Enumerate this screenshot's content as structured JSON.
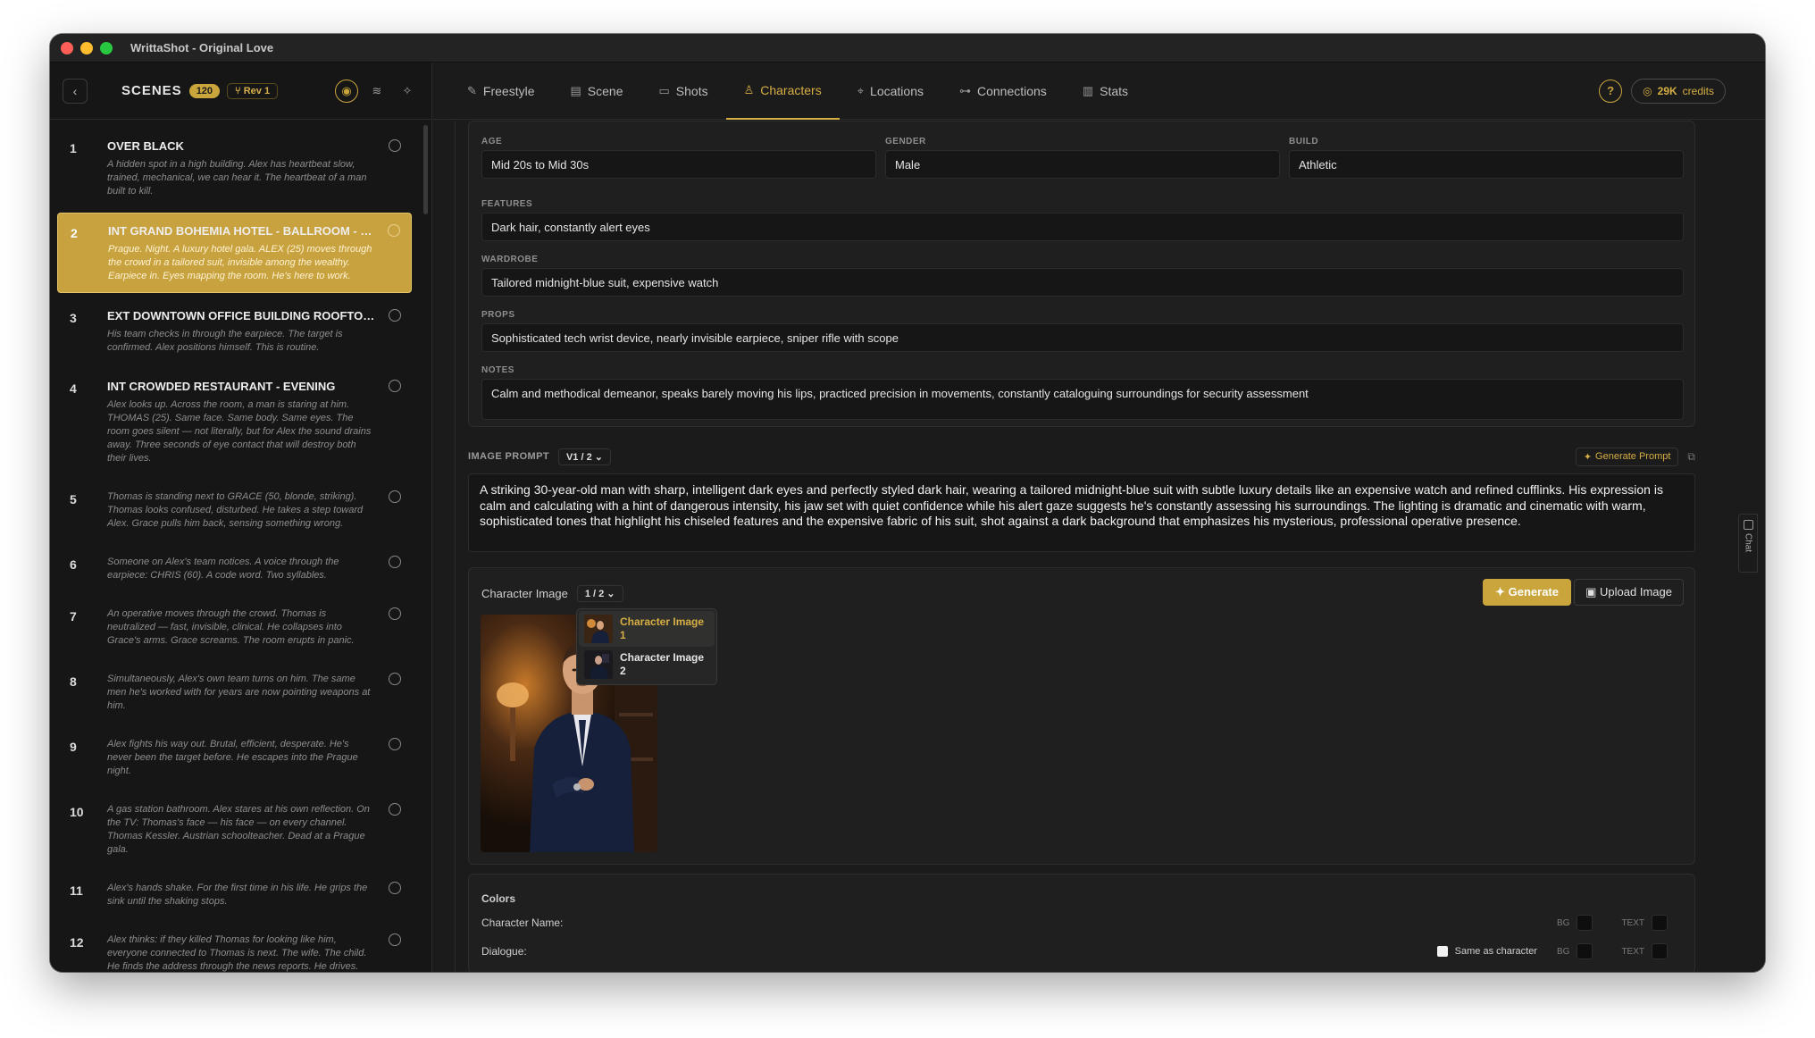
{
  "window": {
    "title": "WrittaShot - Original Love"
  },
  "sidebar": {
    "title": "SCENES",
    "count": "120",
    "rev": "Rev 1",
    "scenes": [
      {
        "num": "1",
        "heading": "OVER BLACK",
        "desc": "A hidden spot in a high building. Alex has heartbeat slow, trained, mechanical, we can hear it. The heartbeat of a man built to kill."
      },
      {
        "num": "2",
        "heading": "INT GRAND BOHEMIA HOTEL - BALLROOM - NI...",
        "desc": "Prague. Night. A luxury hotel gala. ALEX (25) moves through the crowd in a tailored suit, invisible among the wealthy. Earpiece in. Eyes mapping the room. He's here to work."
      },
      {
        "num": "3",
        "heading": "EXT DOWNTOWN OFFICE BUILDING ROOFTOP -...",
        "desc": "His team checks in through the earpiece. The target is confirmed. Alex positions himself. This is routine."
      },
      {
        "num": "4",
        "heading": "INT CROWDED RESTAURANT - EVENING",
        "desc": "Alex looks up. Across the room, a man is staring at him. THOMAS (25). Same face. Same body. Same eyes. The room goes silent — not literally, but for Alex the sound drains away. Three seconds of eye contact that will destroy both their lives."
      },
      {
        "num": "5",
        "heading": "",
        "desc": "Thomas is standing next to GRACE (50, blonde, striking). Thomas looks confused, disturbed. He takes a step toward Alex. Grace pulls him back, sensing something wrong."
      },
      {
        "num": "6",
        "heading": "",
        "desc": "Someone on Alex's team notices. A voice through the earpiece: CHRIS (60). A code word. Two syllables."
      },
      {
        "num": "7",
        "heading": "",
        "desc": "An operative moves through the crowd. Thomas is neutralized — fast, invisible, clinical. He collapses into Grace's arms. Grace screams. The room erupts in panic."
      },
      {
        "num": "8",
        "heading": "",
        "desc": "Simultaneously, Alex's own team turns on him. The same men he's worked with for years are now pointing weapons at him."
      },
      {
        "num": "9",
        "heading": "",
        "desc": "Alex fights his way out. Brutal, efficient, desperate. He's never been the target before. He escapes into the Prague night."
      },
      {
        "num": "10",
        "heading": "",
        "desc": "A gas station bathroom. Alex stares at his own reflection. On the TV: Thomas's face — his face — on every channel. Thomas Kessler. Austrian schoolteacher. Dead at a Prague gala."
      },
      {
        "num": "11",
        "heading": "",
        "desc": "Alex's hands shake. For the first time in his life. He grips the sink until the shaking stops."
      },
      {
        "num": "12",
        "heading": "",
        "desc": "Alex thinks: if they killed Thomas for looking like him, everyone connected to Thomas is next. The wife. The child. He finds the address through the news reports. He drives."
      }
    ]
  },
  "tabs": [
    {
      "label": "Freestyle",
      "icon": "edit-icon"
    },
    {
      "label": "Scene",
      "icon": "document-icon"
    },
    {
      "label": "Shots",
      "icon": "camera-icon"
    },
    {
      "label": "Characters",
      "icon": "person-icon"
    },
    {
      "label": "Locations",
      "icon": "pin-icon"
    },
    {
      "label": "Connections",
      "icon": "link-icon"
    },
    {
      "label": "Stats",
      "icon": "chart-icon"
    }
  ],
  "credits": {
    "amount": "29K",
    "label": "credits"
  },
  "character": {
    "age_label": "AGE",
    "age": "Mid 20s to Mid 30s",
    "gender_label": "GENDER",
    "gender": "Male",
    "build_label": "BUILD",
    "build": "Athletic",
    "features_label": "FEATURES",
    "features": "Dark hair, constantly alert eyes",
    "wardrobe_label": "WARDROBE",
    "wardrobe": "Tailored midnight-blue suit, expensive watch",
    "props_label": "PROPS",
    "props": "Sophisticated tech wrist device, nearly invisible earpiece, sniper rifle with scope",
    "notes_label": "NOTES",
    "notes": "Calm and methodical demeanor, speaks barely moving his lips, practiced precision in movements, constantly cataloguing surroundings for security assessment"
  },
  "image_prompt": {
    "label": "IMAGE PROMPT",
    "version": "V1 / 2",
    "generate_label": "Generate Prompt",
    "text": "A striking 30-year-old man with sharp, intelligent dark eyes and perfectly styled dark hair, wearing a tailored midnight-blue suit with subtle luxury details like an expensive watch and refined cufflinks. His expression is calm and calculating with a hint of dangerous intensity, his jaw set with quiet confidence while his alert gaze suggests he's constantly assessing his surroundings. The lighting is dramatic and cinematic with warm, sophisticated tones that highlight his chiseled features and the expensive fabric of his suit, shot against a dark background that emphasizes his mysterious, professional operative presence."
  },
  "character_image": {
    "label": "Character Image",
    "version": "1 / 2",
    "generate_label": "Generate",
    "upload_label": "Upload Image",
    "options": [
      "Character Image 1",
      "Character Image 2"
    ]
  },
  "colors": {
    "title": "Colors",
    "name_label": "Character Name:",
    "dialogue_label": "Dialogue:",
    "same_label": "Same as character",
    "bg": "BG",
    "text": "TEXT"
  },
  "chat": {
    "label": "Chat"
  },
  "palette": {
    "accent": "#c9a53b",
    "bg": "#1b1b1b"
  }
}
